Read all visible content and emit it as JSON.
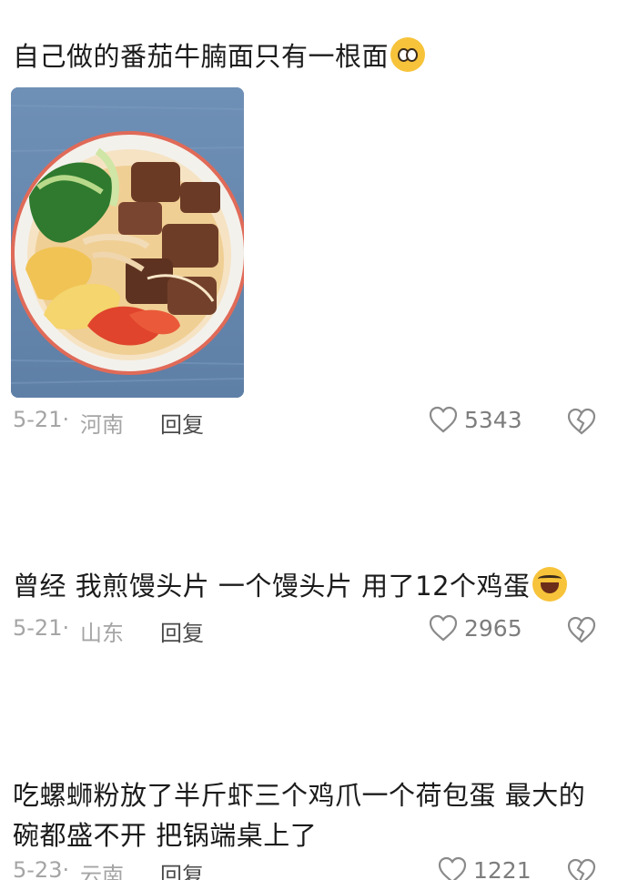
{
  "comments": [
    {
      "text": "自己做的番茄牛腩面只有一根面",
      "emoji": "pleading-face-emoji",
      "has_photo": true,
      "photo_alt": "",
      "date": "5-21·",
      "location": "河南",
      "reply_label": "回复",
      "like_count": "5343"
    },
    {
      "text": "曾经 我煎馒头片 一个馒头片 用了12个鸡蛋",
      "emoji": "rolling-laughing-emoji",
      "date": "5-21·",
      "location": "山东",
      "reply_label": "回复",
      "like_count": "2965"
    },
    {
      "text": "吃螺蛳粉放了半斤虾三个鸡爪一个荷包蛋 最大的碗都盛不开 把锅端桌上了",
      "date": "5-23·",
      "location": "云南",
      "reply_label": "回复",
      "like_count": "1221"
    }
  ],
  "icons": {
    "like": "heart-outline-icon",
    "dislike": "broken-heart-icon"
  },
  "colors": {
    "meta_gray": "#a5a5a5",
    "reply_gray": "#4a4a4a",
    "count_gray": "#7d7d7d",
    "icon_gray": "#8a8a8a"
  }
}
